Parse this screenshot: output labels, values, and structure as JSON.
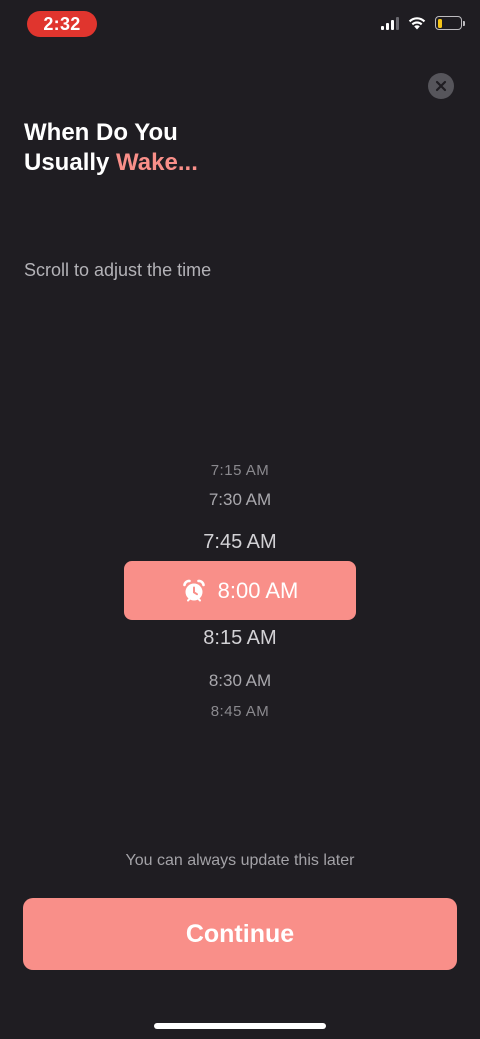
{
  "status_bar": {
    "time": "2:32",
    "battery_level": 0.2,
    "battery_color": "#f5c518",
    "time_pill_color": "#e0352e"
  },
  "header": {
    "close_icon": "close-icon",
    "title_line1": "When Do You",
    "title_line2_prefix": "Usually ",
    "title_line2_accent": "Wake..."
  },
  "hint": "Scroll to adjust the time",
  "picker": {
    "items_above": [
      "7:15 AM",
      "7:30 AM",
      "7:45 AM"
    ],
    "selected": "8:00 AM",
    "selected_icon": "alarm-clock-icon",
    "items_below": [
      "8:15 AM",
      "8:30 AM",
      "8:45 AM"
    ]
  },
  "footer": {
    "note": "You can always update this later",
    "continue_label": "Continue"
  },
  "colors": {
    "background": "#1f1d22",
    "accent": "#f98f89"
  }
}
